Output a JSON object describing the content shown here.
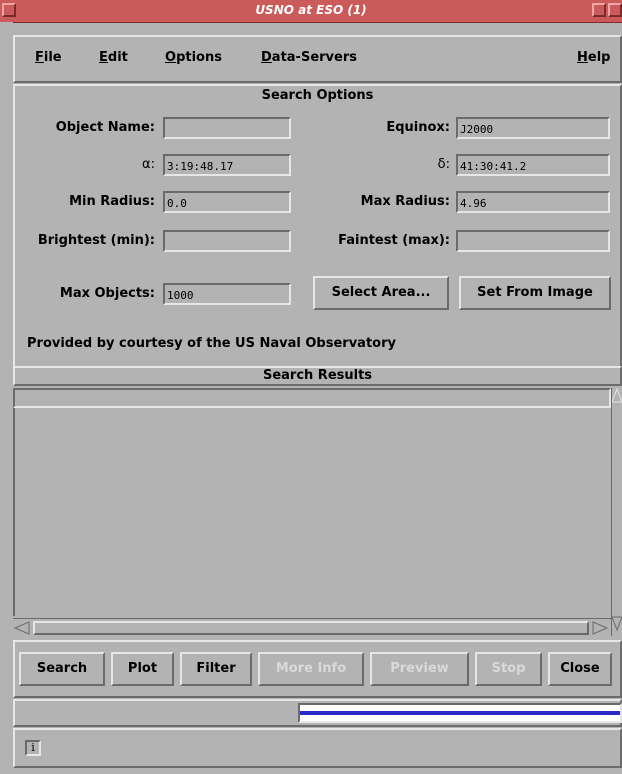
{
  "window": {
    "title": "USNO at ESO (1)"
  },
  "menu": {
    "file": "File",
    "edit": "Edit",
    "options": "Options",
    "data_servers": "Data-Servers",
    "help": "Help"
  },
  "search_options": {
    "header": "Search Options",
    "object_name_label": "Object Name:",
    "object_name_value": "",
    "equinox_label": "Equinox:",
    "equinox_value": "J2000",
    "alpha_label": "α:",
    "alpha_value": "3:19:48.17",
    "delta_label": "δ:",
    "delta_value": "41:30:41.2",
    "min_radius_label": "Min Radius:",
    "min_radius_value": "0.0",
    "max_radius_label": "Max Radius:",
    "max_radius_value": "4.96",
    "brightest_label": "Brightest (min):",
    "brightest_value": "",
    "faintest_label": "Faintest (max):",
    "faintest_value": "",
    "max_objects_label": "Max Objects:",
    "max_objects_value": "1000",
    "select_area_label": "Select Area...",
    "set_from_image_label": "Set From Image",
    "credit": "Provided by courtesy of the US Naval Observatory"
  },
  "search_results": {
    "header": "Search Results"
  },
  "actions": {
    "search": "Search",
    "plot": "Plot",
    "filter": "Filter",
    "more_info": "More Info",
    "preview": "Preview",
    "stop": "Stop",
    "close": "Close"
  },
  "status": {
    "info_icon": "i"
  },
  "icons": {
    "menu": "window-menu-icon",
    "iconify": "iconify-icon",
    "info": "info-icon"
  }
}
